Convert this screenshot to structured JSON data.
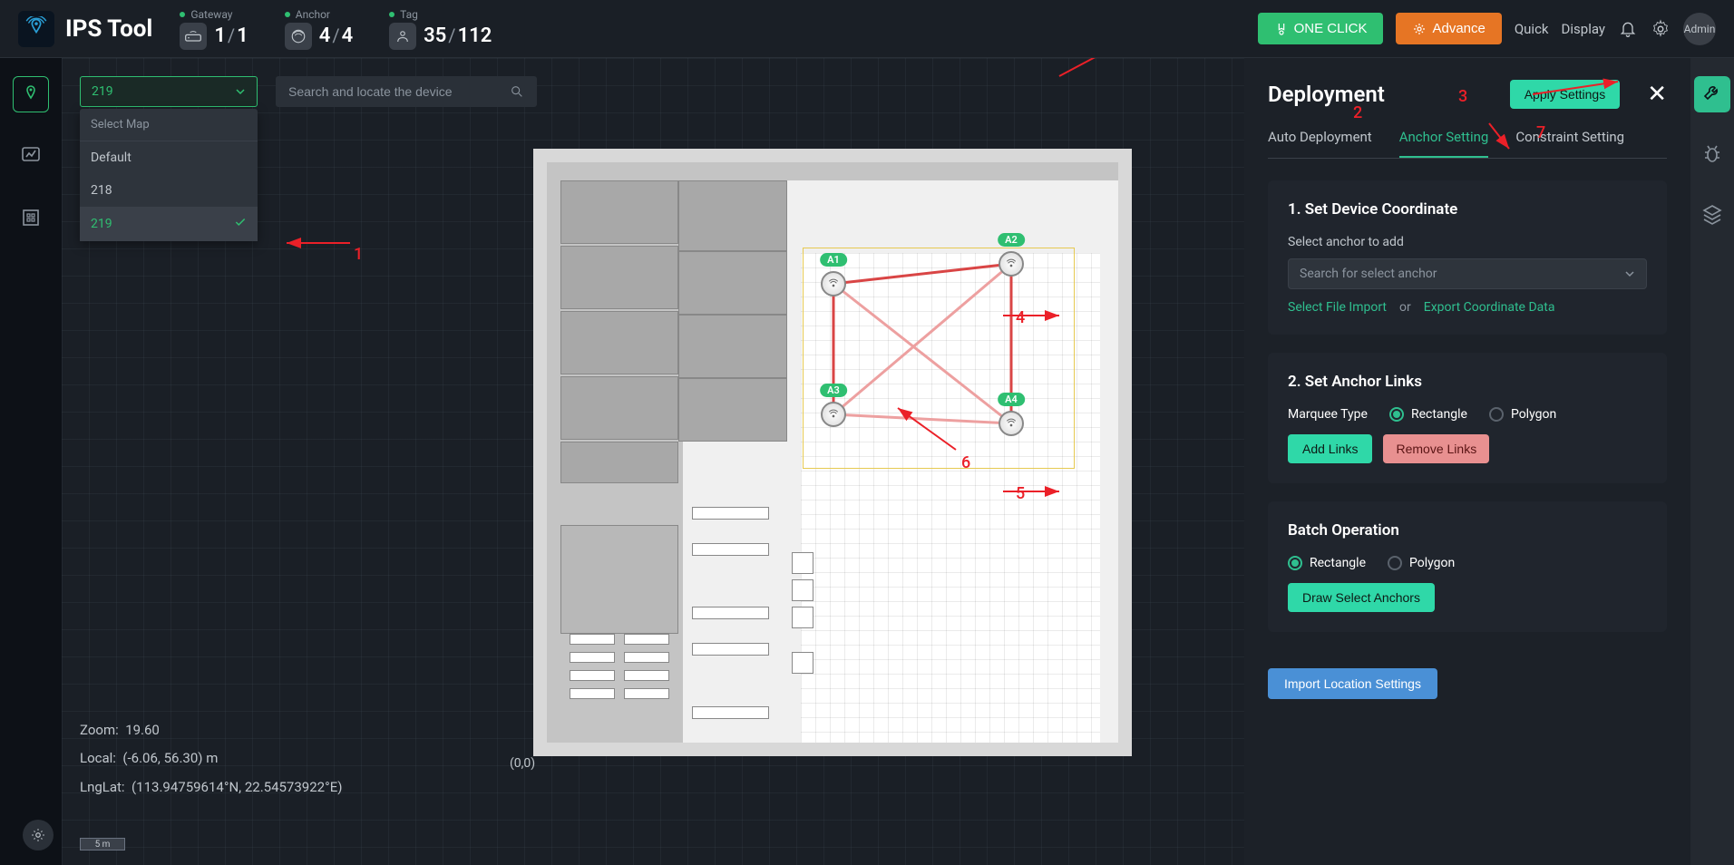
{
  "app": {
    "name": "IPS Tool"
  },
  "header": {
    "stats": {
      "gateway": {
        "label": "Gateway",
        "connected": "1",
        "total": "1"
      },
      "anchor": {
        "label": "Anchor",
        "connected": "4",
        "total": "4"
      },
      "tag": {
        "label": "Tag",
        "connected": "35",
        "total": "112"
      }
    },
    "oneClick": "ONE CLICK",
    "advance": "Advance",
    "quick": "Quick",
    "display": "Display",
    "admin": "Admin"
  },
  "mapSelect": {
    "value": "219",
    "header": "Select Map",
    "options": [
      "Default",
      "218",
      "219"
    ],
    "selectedIndex": 2
  },
  "search": {
    "placeholder": "Search and locate the device"
  },
  "anchors": [
    {
      "id": "A1"
    },
    {
      "id": "A2"
    },
    {
      "id": "A3"
    },
    {
      "id": "A4"
    }
  ],
  "coords": {
    "zoomLabel": "Zoom:",
    "zoom": "19.60",
    "localLabel": "Local:",
    "local": "(-6.06,  56.30)  m",
    "lnglatLabel": "LngLat:",
    "lnglat": "(113.94759614°N,  22.54573922°E)",
    "origin": "(0,0)",
    "scale": "5 m"
  },
  "annotations": {
    "n1": "1",
    "n2": "2",
    "n3": "3",
    "n4": "4",
    "n5": "5",
    "n6": "6",
    "n7": "7"
  },
  "panel": {
    "title": "Deployment",
    "apply": "Apply Settings",
    "tabs": {
      "auto": "Auto Deployment",
      "anchor": "Anchor Setting",
      "constraint": "Constraint Setting"
    },
    "sec1": {
      "title": "1. Set Device Coordinate",
      "selectLabel": "Select anchor to add",
      "placeholder": "Search for select anchor",
      "fileImport": "Select File Import",
      "or": "or",
      "export": "Export Coordinate Data"
    },
    "sec2": {
      "title": "2. Set Anchor Links",
      "marquee": "Marquee Type",
      "rect": "Rectangle",
      "poly": "Polygon",
      "add": "Add Links",
      "remove": "Remove Links"
    },
    "sec3": {
      "title": "Batch Operation",
      "rect": "Rectangle",
      "poly": "Polygon",
      "draw": "Draw Select Anchors"
    },
    "import": "Import Location Settings"
  }
}
